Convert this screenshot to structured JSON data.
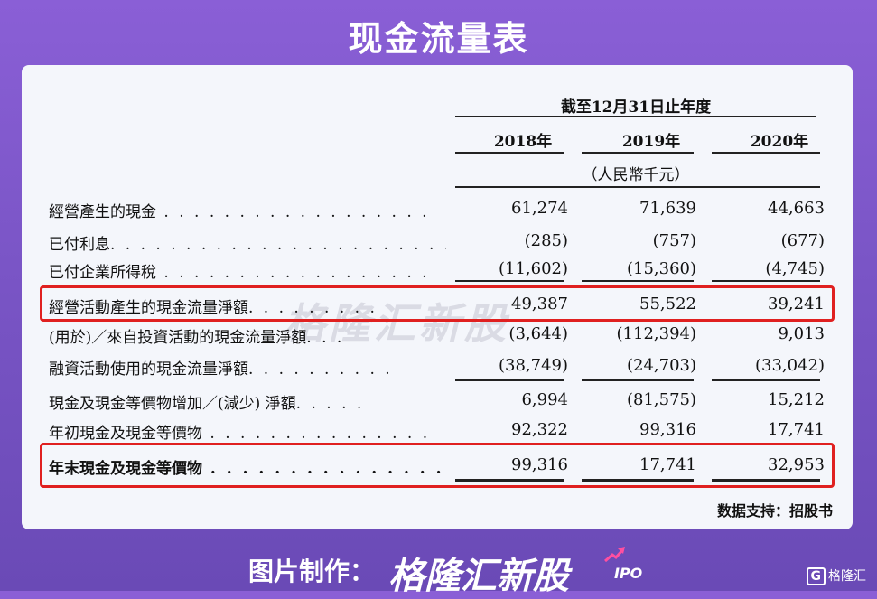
{
  "page": {
    "title": "现金流量表",
    "source": "数据支持：招股书",
    "watermark": "格隆汇新股",
    "footer_label": "图片制作：",
    "footer_brand": "格隆汇新股",
    "footer_ipo": "IPO",
    "corner_logo": "格隆汇",
    "corner_logo_mark": "G"
  },
  "table": {
    "period_header": "截至12月31日止年度",
    "years": [
      "2018年",
      "2019年",
      "2020年"
    ],
    "unit": "（人民幣千元）",
    "rows": [
      {
        "label": "經營產生的現金",
        "dots": " . . . . . . . . . . . . . . . . . .",
        "v": [
          "61,274",
          "71,639",
          "44,663"
        ]
      },
      {
        "label": "已付利息",
        "dots": ". . . . . . . . . . . . . . . . . . . . . . .",
        "v": [
          "(285)",
          "(757)",
          "(677)"
        ]
      },
      {
        "label": "已付企業所得稅",
        "dots": " . . . . . . . . . . . . . . . . . .",
        "v": [
          "(11,602)",
          "(15,360)",
          "(4,745)"
        ]
      },
      {
        "label": "經營活動產生的現金流量淨額",
        "dots": ". . . . . . . . .",
        "v": [
          "49,387",
          "55,522",
          "39,241"
        ]
      },
      {
        "label": "(用於)／來自投資活動的現金流量淨額",
        "dots": ". . .",
        "v": [
          "(3,644)",
          "(112,394)",
          "9,013"
        ]
      },
      {
        "label": "融資活動使用的現金流量淨額",
        "dots": ". . . . . . . . . .",
        "v": [
          "(38,749)",
          "(24,703)",
          "(33,042)"
        ]
      },
      {
        "label": "現金及現金等價物增加／(減少) 淨額",
        "dots": ". . . . .",
        "v": [
          "6,994",
          "(81,575)",
          "15,212"
        ]
      },
      {
        "label": "年初現金及現金等價物",
        "dots": " . . . . . . . . . . . . . . .",
        "v": [
          "92,322",
          "99,316",
          "17,741"
        ]
      },
      {
        "label": "年末現金及現金等價物",
        "dots": " . . . . . . . . . . . . . . .",
        "v": [
          "99,316",
          "17,741",
          "32,953"
        ]
      }
    ]
  },
  "colors": {
    "background": "#7a55c6",
    "highlight": "#e02020",
    "card": "#f4f6fb"
  }
}
